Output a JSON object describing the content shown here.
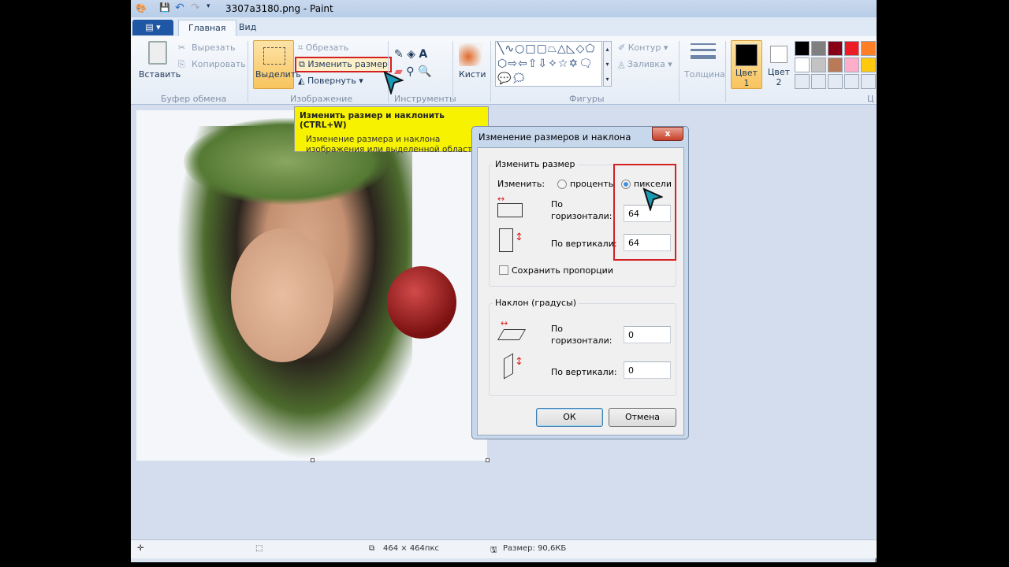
{
  "window": {
    "title": "3307a3180.png - Paint"
  },
  "tabs": [
    {
      "label": "Главная"
    },
    {
      "label": "Вид"
    }
  ],
  "ribbon": {
    "clipboard": {
      "paste": "Вставить",
      "cut": "Вырезать",
      "copy": "Копировать",
      "group": "Буфер обмена"
    },
    "image": {
      "select": "Выделить",
      "crop": "Обрезать",
      "resize": "Изменить размер",
      "rotate": "Повернуть",
      "group": "Изображение"
    },
    "tools": {
      "group": "Инструменты"
    },
    "brushes": {
      "label": "Кисти"
    },
    "shapes": {
      "outline": "Контур",
      "fill": "Заливка",
      "group": "Фигуры",
      "glyphs": "╲∿○□▢⏢△◺◇⬠⬡⇨⇦⇧⇩✧☆✡🗨💬🗯"
    },
    "size": {
      "label": "Толщина"
    },
    "color1": {
      "label": "Цвет",
      "num": "1"
    },
    "color2": {
      "label": "Цвет",
      "num": "2"
    },
    "colors_group": "Ц",
    "palette": [
      "#000000",
      "#7f7f7f",
      "#880015",
      "#ed1c24",
      "#ff7f27",
      "#ffffff",
      "#c3c3c3",
      "#b97a57",
      "#ffaec9",
      "#ffc90e"
    ]
  },
  "tooltip": {
    "title": "Изменить размер и наклонить (CTRL+W)",
    "body": "Изменение размера и наклона изображения или выделенной области."
  },
  "dialog": {
    "title": "Изменение размеров и наклона",
    "close": "x",
    "resize": {
      "group": "Изменить размер",
      "by": "Изменить:",
      "percent": "проценты",
      "pixels": "пиксели",
      "horizontal": "По горизонтали:",
      "vertical": "По вертикали:",
      "h_value": "64",
      "v_value": "64",
      "keep_ratio": "Сохранить пропорции"
    },
    "skew": {
      "group": "Наклон (градусы)",
      "horizontal": "По горизонтали:",
      "vertical": "По вертикали:",
      "h_value": "0",
      "v_value": "0"
    },
    "ok": "ОК",
    "cancel": "Отмена"
  },
  "status": {
    "dimensions": "464 × 464пкс",
    "size": "Размер: 90,6КБ"
  }
}
